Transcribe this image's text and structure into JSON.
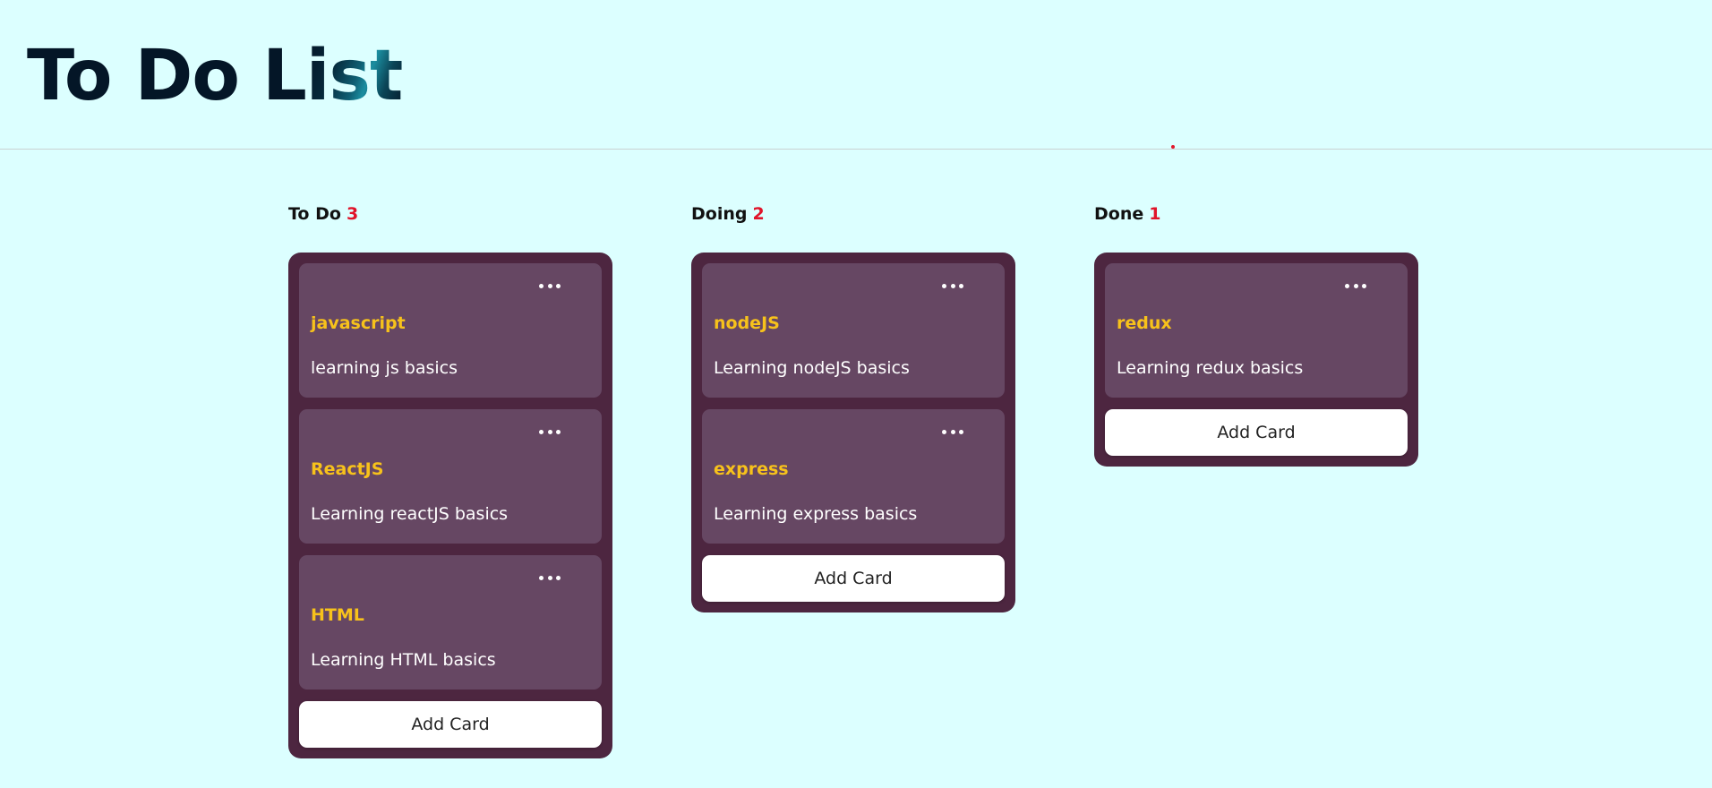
{
  "header": {
    "title_prefix": "To Do L",
    "title_highlight": "ist"
  },
  "colors": {
    "background": "#dcffff",
    "column_background": "#4d2640",
    "card_background": "#664763",
    "card_title": "#f7c21b",
    "count_accent": "#e0142a"
  },
  "columns": [
    {
      "title": "To Do",
      "count": "3",
      "add_label": "Add Card",
      "cards": [
        {
          "title": "javascript",
          "description": "learning js basics"
        },
        {
          "title": "ReactJS",
          "description": "Learning reactJS basics"
        },
        {
          "title": "HTML",
          "description": "Learning HTML basics"
        }
      ]
    },
    {
      "title": "Doing",
      "count": "2",
      "add_label": "Add Card",
      "cards": [
        {
          "title": "nodeJS",
          "description": "Learning nodeJS basics"
        },
        {
          "title": "express",
          "description": "Learning express basics"
        }
      ]
    },
    {
      "title": "Done",
      "count": "1",
      "add_label": "Add Card",
      "cards": [
        {
          "title": "redux",
          "description": "Learning redux basics"
        }
      ]
    }
  ]
}
